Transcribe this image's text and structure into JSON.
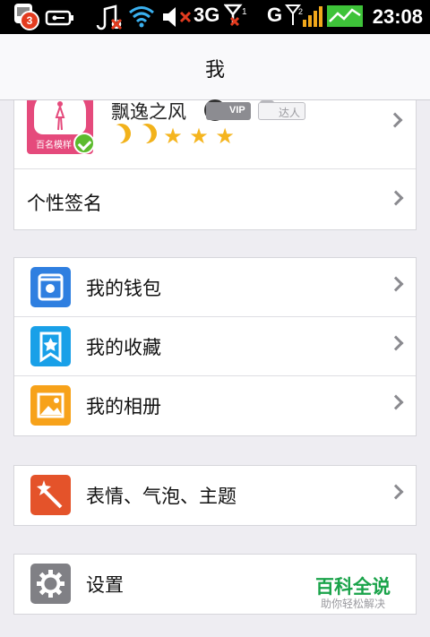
{
  "status_bar": {
    "badge_count": "3",
    "network": "3G",
    "carrier": "G",
    "time": "23:08",
    "icons": [
      "usb-icon",
      "music-off-icon",
      "wifi-icon",
      "volume-mute-icon",
      "signal-icon",
      "battery-icon"
    ]
  },
  "header": {
    "title": "我"
  },
  "profile": {
    "nickname": "飘逸之风",
    "vip_label": "VIP",
    "daren_label": "达人",
    "avatar_text": "百名模样",
    "level_icons": [
      "moon",
      "moon",
      "star",
      "star",
      "star"
    ],
    "signature_label": "个性签名"
  },
  "groups": [
    {
      "items": [
        {
          "label": "我的钱包",
          "icon": "wallet-icon",
          "color": "#2f7fe0"
        },
        {
          "label": "我的收藏",
          "icon": "favorite-icon",
          "color": "#19a0e8"
        },
        {
          "label": "我的相册",
          "icon": "album-icon",
          "color": "#f7a21a"
        }
      ]
    },
    {
      "items": [
        {
          "label": "表情、气泡、主题",
          "icon": "magic-wand-icon",
          "color": "#e4532a"
        }
      ]
    },
    {
      "items": [
        {
          "label": "设置",
          "icon": "gear-icon",
          "color": "#808085"
        }
      ]
    }
  ],
  "watermark": {
    "main": "百科全说",
    "sub": "助你轻松解决"
  },
  "colors": {
    "accent_green": "#1aa34a",
    "background": "#eeedf2"
  }
}
